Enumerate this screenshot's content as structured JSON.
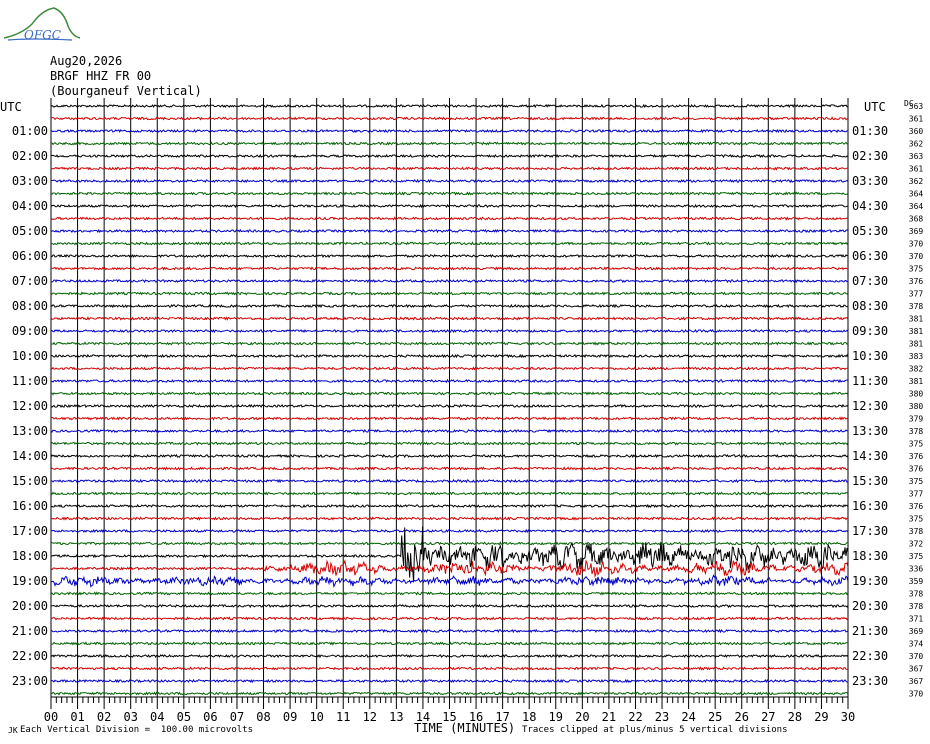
{
  "header": {
    "logo_text": "OFGC",
    "date": "Aug20,2026",
    "station": "BRGF HHZ FR 00",
    "location": "(Bourganeuf Vertical)"
  },
  "axes": {
    "left_label": "UTC",
    "right_label": "UTC",
    "right_extra_label": "DC",
    "x_label": "TIME (MINUTES)",
    "x_ticks": [
      "00",
      "01",
      "02",
      "03",
      "04",
      "05",
      "06",
      "07",
      "08",
      "09",
      "10",
      "11",
      "12",
      "13",
      "14",
      "15",
      "16",
      "17",
      "18",
      "19",
      "20",
      "21",
      "22",
      "23",
      "24",
      "25",
      "26",
      "27",
      "28",
      "29",
      "30"
    ]
  },
  "footer": {
    "scale_note": "Each Vertical Division =  100.00 microvolts",
    "clip_note": "Traces clipped at plus/minus 5 vertical divisions",
    "corner_mark": "JK"
  },
  "chart_data": {
    "type": "line",
    "title": "",
    "xlabel": "TIME (MINUTES)",
    "xlim": [
      0,
      30
    ],
    "trace_count": 48,
    "trace_colors": [
      "#000000",
      "#d40000",
      "#0000c8",
      "#006400"
    ],
    "grid": true,
    "left_hour_labels": [
      "",
      "01:00",
      "02:00",
      "03:00",
      "04:00",
      "05:00",
      "06:00",
      "07:00",
      "08:00",
      "09:00",
      "10:00",
      "11:00",
      "12:00",
      "13:00",
      "14:00",
      "15:00",
      "16:00",
      "17:00",
      "18:00",
      "19:00",
      "20:00",
      "21:00",
      "22:00",
      "23:00"
    ],
    "right_hour_labels": [
      "",
      "01:30",
      "02:30",
      "03:30",
      "04:30",
      "05:30",
      "06:30",
      "07:30",
      "08:30",
      "09:30",
      "10:30",
      "11:30",
      "12:30",
      "13:30",
      "14:30",
      "15:30",
      "16:30",
      "17:30",
      "18:30",
      "19:30",
      "20:30",
      "21:30",
      "22:30",
      "23:30"
    ],
    "dc_offsets": [
      363,
      361,
      360,
      362,
      363,
      361,
      362,
      364,
      364,
      368,
      369,
      370,
      370,
      375,
      376,
      377,
      378,
      381,
      381,
      381,
      383,
      382,
      381,
      380,
      380,
      379,
      378,
      375,
      376,
      376,
      375,
      377,
      376,
      375,
      378,
      372,
      375,
      336,
      359,
      378,
      378,
      371,
      369,
      374,
      370,
      367,
      367,
      370
    ],
    "events": [
      {
        "trace": 36,
        "start_minute": 13.2,
        "peak_amplitude_div": 1.6,
        "note": "large event onset"
      },
      {
        "trace": 37,
        "start_minute": 8.0,
        "peak_amplitude_div": 0.8
      },
      {
        "trace": 38,
        "start_minute": 0.0,
        "peak_amplitude_div": 0.5
      }
    ]
  }
}
